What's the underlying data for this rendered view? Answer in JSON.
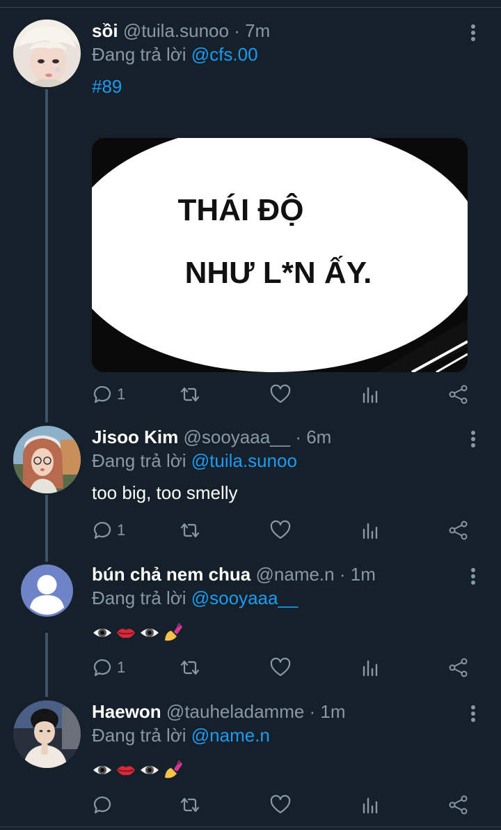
{
  "tweets": [
    {
      "name": "sồi",
      "handle": "@tuila.sunoo",
      "time": " · 7m",
      "replying_prefix": "Đang trả lời ",
      "replying_to": "@cfs.00",
      "text": "#89",
      "image_text_line1": "THÁI ĐỘ",
      "image_text_line2": "NHƯ L*N ẤY.",
      "reply_count": "1"
    },
    {
      "name": "Jisoo Kim",
      "handle": "@sooyaaa__",
      "time": " · 6m",
      "replying_prefix": "Đang trả lời ",
      "replying_to": "@tuila.sunoo",
      "text": "too big, too smelly",
      "reply_count": "1"
    },
    {
      "name": "bún chả nem chua",
      "handle": "@name.n",
      "time": " · 1m",
      "replying_prefix": "Đang trả lời ",
      "replying_to": "@sooyaaa__",
      "text_emojis": [
        "eye",
        "lips",
        "eye",
        "nail-polish"
      ],
      "reply_count": "1"
    },
    {
      "name": "Haewon",
      "handle": "@tauheladamme",
      "time": " · 1m",
      "replying_prefix": "Đang trả lời ",
      "replying_to": "@name.n",
      "text_emojis": [
        "eye",
        "lips",
        "eye",
        "nail-polish"
      ],
      "reply_count": ""
    }
  ],
  "icons": [
    "reply-icon",
    "retweet-icon",
    "like-icon",
    "analytics-icon",
    "share-icon",
    "more-icon"
  ],
  "colors": {
    "background": "#15202b",
    "accent": "#1d9bf0",
    "secondary_text": "#8899a6",
    "thread_line": "#3d5466"
  }
}
